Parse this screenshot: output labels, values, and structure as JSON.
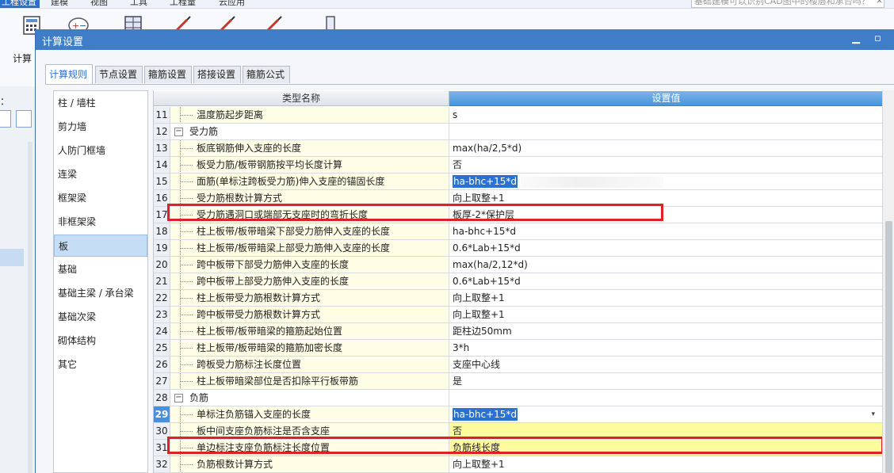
{
  "app": {
    "menu": [
      "工程设置",
      "建模",
      "视图",
      "工具",
      "工程量",
      "云应用"
    ],
    "search_placeholder": "基础建模可以识别CAD图中的楼层和承台吗？",
    "search_close": "×",
    "ribbon_calc_label": "计算"
  },
  "dialog": {
    "title": "计算设置",
    "minimize": "▁",
    "maximize": "▫"
  },
  "tabs": [
    "计算规则",
    "节点设置",
    "箍筋设置",
    "搭接设置",
    "箍筋公式"
  ],
  "categories": [
    "柱 / 墙柱",
    "剪力墙",
    "人防门框墙",
    "连梁",
    "框架梁",
    "非框架梁",
    "板",
    "基础",
    "基础主梁 / 承台梁",
    "基础次梁",
    "砌体结构",
    "其它"
  ],
  "selected_category": "板",
  "grid": {
    "col_name": "类型名称",
    "col_value": "设置值",
    "rows": [
      {
        "num": "11",
        "name": "温度筋起步距离",
        "value": "s"
      },
      {
        "num": "12",
        "name": "受力筋",
        "value": "",
        "group": true,
        "expander": "−"
      },
      {
        "num": "13",
        "name": "板底钢筋伸入支座的长度",
        "value": "max(ha/2,5*d)"
      },
      {
        "num": "14",
        "name": "板受力筋/板带钢筋按平均长度计算",
        "value": "否"
      },
      {
        "num": "15",
        "name": "面筋(单标注跨板受力筋)伸入支座的锚固长度",
        "value": "ha-bhc+15*d"
      },
      {
        "num": "16",
        "name": "受力筋根数计算方式",
        "value": "向上取整+1"
      },
      {
        "num": "17",
        "name": "受力筋遇洞口或端部无支座时的弯折长度",
        "value": "板厚-2*保护层"
      },
      {
        "num": "18",
        "name": "柱上板带/板带暗梁下部受力筋伸入支座的长度",
        "value": "ha-bhc+15*d"
      },
      {
        "num": "19",
        "name": "柱上板带/板带暗梁上部受力筋伸入支座的长度",
        "value": "0.6*Lab+15*d"
      },
      {
        "num": "20",
        "name": "跨中板带下部受力筋伸入支座的长度",
        "value": "max(ha/2,12*d)"
      },
      {
        "num": "21",
        "name": "跨中板带上部受力筋伸入支座的长度",
        "value": "0.6*Lab+15*d"
      },
      {
        "num": "22",
        "name": "柱上板带受力筋根数计算方式",
        "value": "向上取整+1"
      },
      {
        "num": "23",
        "name": "跨中板带受力筋根数计算方式",
        "value": "向上取整+1"
      },
      {
        "num": "24",
        "name": "柱上板带/板带暗梁的箍筋起始位置",
        "value": "距柱边50mm"
      },
      {
        "num": "25",
        "name": "柱上板带/板带暗梁的箍筋加密长度",
        "value": "3*h"
      },
      {
        "num": "26",
        "name": "跨板受力筋标注长度位置",
        "value": "支座中心线"
      },
      {
        "num": "27",
        "name": "柱上板带暗梁部位是否扣除平行板带筋",
        "value": "是"
      },
      {
        "num": "28",
        "name": "负筋",
        "value": "",
        "group": true,
        "expander": "−"
      },
      {
        "num": "29",
        "name": "单标注负筋锚入支座的长度",
        "value": "ha-bhc+15*d",
        "current": true,
        "dropdown": "▾"
      },
      {
        "num": "30",
        "name": "板中间支座负筋标注是否含支座",
        "value": "否",
        "yellow": true
      },
      {
        "num": "31",
        "name": "单边标注支座负筋标注长度位置",
        "value": "负筋线长度",
        "yellow": true
      },
      {
        "num": "32",
        "name": "负筋根数计算方式",
        "value": "向上取整+1"
      }
    ]
  },
  "colors": {
    "title_bar": "#3f7dc9",
    "highlight_box": "#dc2128",
    "selection": "#2a71d0",
    "name_cell_bg": "#fefde6",
    "yellow_value_bg": "#fefb9e"
  }
}
